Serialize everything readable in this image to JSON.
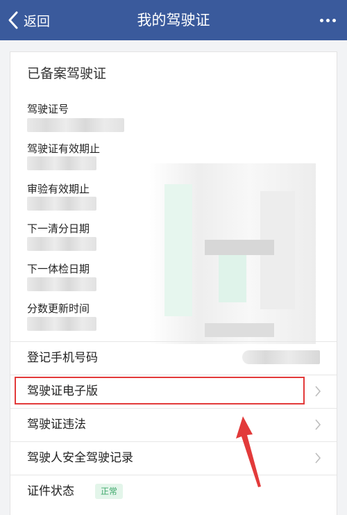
{
  "header": {
    "back_label": "返回",
    "title": "我的驾驶证"
  },
  "card": {
    "title": "已备案驾驶证",
    "fields": [
      {
        "label": "驾驶证号"
      },
      {
        "label": "驾驶证有效期止"
      },
      {
        "label": "审验有效期止"
      },
      {
        "label": "下一清分日期"
      },
      {
        "label": "下一体检日期"
      },
      {
        "label": "分数更新时间"
      }
    ],
    "rows": {
      "phone": "登记手机号码",
      "ecard": "驾驶证电子版",
      "violations": "驾驶证违法",
      "safety": "驾驶人安全驾驶记录",
      "status": "证件状态",
      "status_badge": "正常"
    }
  },
  "colors": {
    "nav_bg": "#3a5a9c",
    "highlight": "#e23a3a",
    "badge_green": "#3ea86b"
  }
}
